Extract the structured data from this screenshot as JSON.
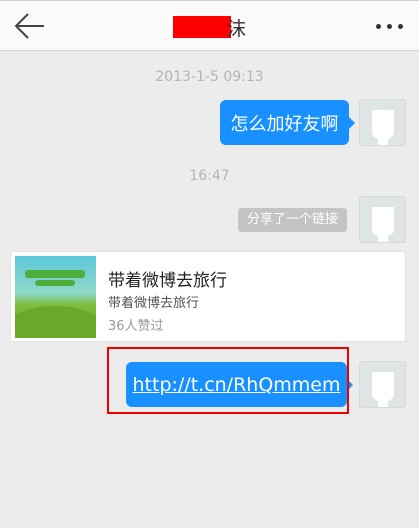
{
  "header": {
    "title_visible": "沫",
    "more_icon": "more-dots-icon",
    "back_icon": "back-arrow-icon"
  },
  "messages": {
    "timestamp1": "2013-1-5 09:13",
    "msg1": "怎么加好友啊",
    "timestamp2": "16:47",
    "share_label": "分享了一个链接",
    "card": {
      "title": "带着微博去旅行",
      "subtitle": "带着微博去旅行",
      "likes": "36人赞过",
      "thumb_text": "带着微博去旅行"
    },
    "link": "http://t.cn/RhQmmem"
  },
  "colors": {
    "bubble": "#1890ff",
    "highlight": "#ee0000"
  }
}
